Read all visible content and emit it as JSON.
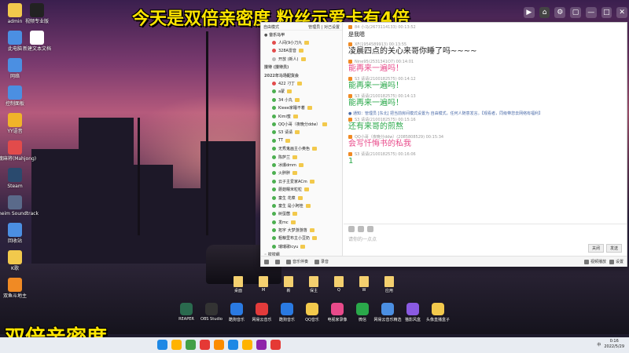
{
  "banners": {
    "top": "今天是双倍亲密度 粉丝示爱卡有4倍",
    "bottom": "双倍亲密度"
  },
  "desktop_icons": [
    {
      "label": "admin",
      "color": "#f2c94c"
    },
    {
      "label": "此电脑",
      "color": "#4b8fe2"
    },
    {
      "label": "网络",
      "color": "#4b8fe2"
    },
    {
      "label": "控制面板",
      "color": "#4b8fe2"
    },
    {
      "label": "YY语音",
      "color": "#f0b429"
    },
    {
      "label": "雀魂麻将(Mahjong)",
      "color": "#e24b4b"
    },
    {
      "label": "Steam",
      "color": "#2a4a6e"
    },
    {
      "label": "Valheim Soundtrack",
      "color": "#5a6a8a"
    },
    {
      "label": "回收站",
      "color": "#4b8fe2"
    },
    {
      "label": "K歌",
      "color": "#f2c94c"
    },
    {
      "label": "双鱼斗地主",
      "color": "#f08a24"
    }
  ],
  "desktop_icons_col2": [
    {
      "label": "视频专业版",
      "color": "#222"
    },
    {
      "label": "新建文本文档",
      "color": "#fff"
    }
  ],
  "window_controls": [
    "▶",
    "⌂",
    "⚙",
    "▢",
    "—",
    "□",
    "✕"
  ],
  "left_pane": {
    "header_left": "自由模式",
    "header_right": "管理员 |  对己设置",
    "rows": [
      {
        "text": "● 音乐马甲",
        "type": "group",
        "dot": ""
      },
      {
        "text": "人间(9小刀九",
        "type": "sub",
        "dot": "red"
      },
      {
        "text": "328A雷音",
        "type": "sub",
        "dot": "red"
      },
      {
        "text": "开放 (新人)",
        "type": "sub",
        "dot": "gray"
      },
      {
        "text": "接待 (接待员)",
        "type": "group",
        "dot": ""
      },
      {
        "text": "2022年马场配货会",
        "type": "group",
        "dot": ""
      },
      {
        "text": "422 刁丁",
        "type": "sub",
        "dot": "red"
      },
      {
        "text": "a蒙",
        "type": "sub",
        "dot": "green"
      },
      {
        "text": "34 小丸",
        "type": "sub",
        "dot": "green"
      },
      {
        "text": "Kieee家睡不着",
        "type": "sub",
        "dot": "green"
      },
      {
        "text": "Kimi蜜",
        "type": "sub",
        "dot": "green"
      },
      {
        "text": "QQ小哥（夜晚分ddw）",
        "type": "sub",
        "dot": "green"
      },
      {
        "text": "S3 请请",
        "type": "sub",
        "dot": "green"
      },
      {
        "text": "TT",
        "type": "sub",
        "dot": "green"
      },
      {
        "text": "无秀鬼画主小奥色",
        "type": "sub",
        "dot": "green"
      },
      {
        "text": "陈萨兰",
        "type": "sub",
        "dot": "green"
      },
      {
        "text": "冰爆dmm",
        "type": "sub",
        "dot": "green"
      },
      {
        "text": "火胖胖",
        "type": "sub",
        "dot": "green"
      },
      {
        "text": "云子主爱家ACm",
        "type": "sub",
        "dot": "green"
      },
      {
        "text": "蘑菇糯米粒粒",
        "type": "sub",
        "dot": "green"
      },
      {
        "text": "童生 花菜",
        "type": "sub",
        "dot": "green"
      },
      {
        "text": "童生 是小阿桂",
        "type": "sub",
        "dot": "green"
      },
      {
        "text": "树蛋菌",
        "type": "sub",
        "dot": "green"
      },
      {
        "text": "发mc",
        "type": "sub",
        "dot": "green"
      },
      {
        "text": "拓宇  大梦游游落",
        "type": "sub",
        "dot": "green"
      },
      {
        "text": "粗粮里布主小豆奶",
        "type": "sub",
        "dot": "green"
      },
      {
        "text": "瑞瑞歌icyu",
        "type": "sub",
        "dot": "green"
      },
      {
        "text": "◦ 拉拉组",
        "type": "group",
        "dot": ""
      },
      {
        "text": "◦ 600大合战队",
        "type": "group",
        "dot": ""
      },
      {
        "text": "◦ 600大合战队",
        "type": "group",
        "dot": ""
      },
      {
        "text": "马儿翅膀组",
        "type": "red",
        "dot": ""
      }
    ]
  },
  "chat": [
    {
      "who": "84 小马(2673114133)  00:13:52",
      "text": "是我嗯",
      "color": "#222",
      "small": true
    },
    {
      "who": "XF(1954589913)  00:13:55",
      "text": "凌晨四点的关心来哥你睡了吗~~~~",
      "color": "#222",
      "small": false
    },
    {
      "who": "Nine95(2531341O7)  00:14:01",
      "text": "能再来一遍吗！",
      "color": "#e84a8a",
      "small": false
    },
    {
      "who": "S3 请请(2100182575)  00:14:12",
      "text": "能再来一遍吗！",
      "color": "#2aa84a",
      "small": false
    },
    {
      "who": "S3 请请(2100182575)  00:14:13",
      "text": "能再来一遍吗！",
      "color": "#2aa84a",
      "small": false
    },
    {
      "who": "S3 请请(2100182575)  00:15:16",
      "text": "还有来哥的煎熬",
      "color": "#2aa84a",
      "small": false
    },
    {
      "who": "QQ小哥（夜晚分ddw）(2085808529)  00:15:34",
      "text": "会写忏悔书的私我",
      "color": "#e84a8a",
      "small": false
    },
    {
      "who": "S3 请请(2100182575)  00:16:06",
      "text": "1",
      "color": "#2aa84a",
      "small": false
    }
  ],
  "system_msg": "● 通知：管理员 [东北] 把当前房间模式设置为 自由模式，任何人随意发言。【观看者，同级带您去网络有福利】",
  "input": {
    "placeholder": "请你的一点点",
    "send_label": "发送",
    "close_label": "关闭"
  },
  "bottom_bar": {
    "items": [
      "音乐伴奏",
      "录音"
    ],
    "right_items": [
      "视频播放",
      "设置"
    ]
  },
  "folders": [
    "桌面",
    "M",
    "新",
    "保主",
    "Q",
    "W",
    "应用"
  ],
  "apps": [
    {
      "label": "REAPER",
      "color": "#2a6a4e"
    },
    {
      "label": "OBS Studio",
      "color": "#333"
    },
    {
      "label": "酷狗音乐",
      "color": "#2a7ae2"
    },
    {
      "label": "网易云音乐",
      "color": "#e23b3b"
    },
    {
      "label": "酷狗音乐",
      "color": "#2a7ae2"
    },
    {
      "label": "QQ音乐",
      "color": "#f2c94c"
    },
    {
      "label": "电视家录像",
      "color": "#e84a8a"
    },
    {
      "label": "微信",
      "color": "#2aa84a"
    },
    {
      "label": "网易云音乐精选",
      "color": "#4b8fe2"
    },
    {
      "label": "猫影风盒",
      "color": "#8a5ae2"
    },
    {
      "label": "头像直播盒子",
      "color": "#f2c94c"
    }
  ],
  "taskbar": {
    "icons": [
      "#1e88e5",
      "#ffb300",
      "#43a047",
      "#e53935",
      "#fb8c00",
      "#1e88e5",
      "#ffb300",
      "#8e24aa",
      "#e53935"
    ],
    "time": "0:16",
    "date": "2022/5/29",
    "tray": "中"
  }
}
